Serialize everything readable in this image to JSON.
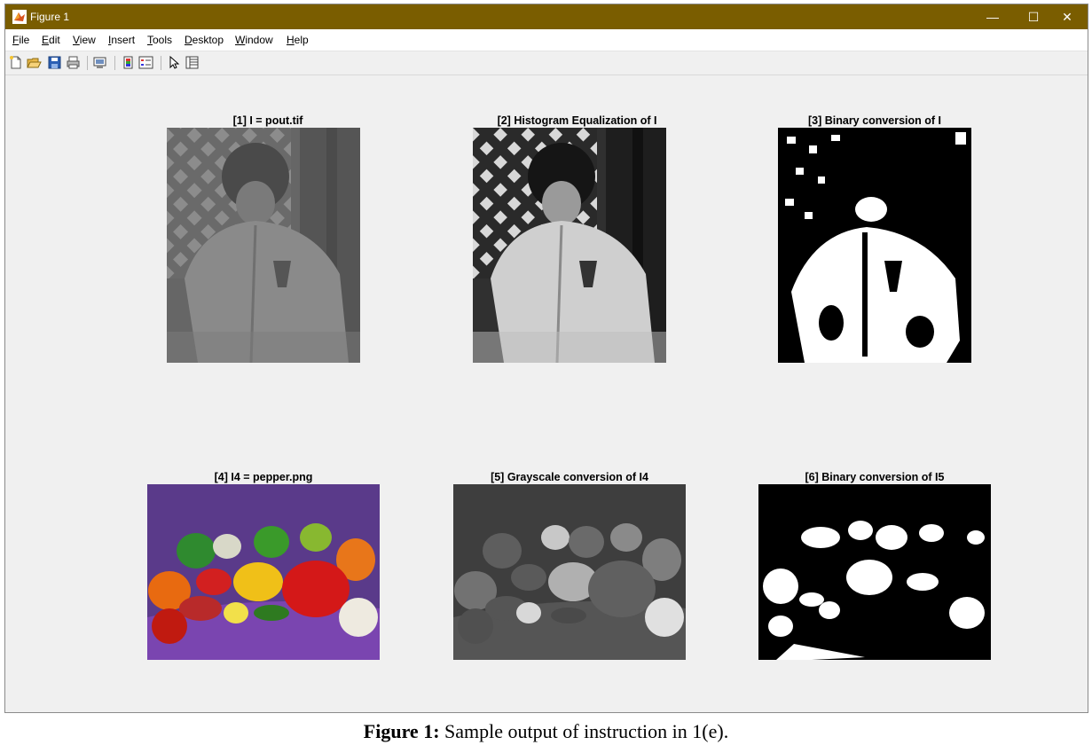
{
  "window": {
    "title": "Figure 1",
    "app_icon": "matlab-icon",
    "controls": [
      "—",
      "☐",
      "✕"
    ],
    "accent": "#7a5d00"
  },
  "menu": [
    {
      "label": "File"
    },
    {
      "label": "Edit"
    },
    {
      "label": "View"
    },
    {
      "label": "Insert"
    },
    {
      "label": "Tools"
    },
    {
      "label": "Desktop"
    },
    {
      "label": "Window"
    },
    {
      "label": "Help"
    }
  ],
  "toolbar": {
    "icons": [
      "new-figure-icon",
      "open-file-icon",
      "save-icon",
      "print-icon",
      "link-plot-icon",
      "colorbar-icon",
      "legend-icon",
      "pointer-icon",
      "property-editor-icon"
    ]
  },
  "subplots": [
    {
      "title": "[1] I = pout.tif"
    },
    {
      "title": "[2] Histogram Equalization of I"
    },
    {
      "title": "[3] Binary conversion of I"
    },
    {
      "title": "[4] I4 = pepper.png"
    },
    {
      "title": "[5] Grayscale conversion of I4"
    },
    {
      "title": "[6] Binary conversion of I5"
    }
  ],
  "caption": {
    "label": "Figure 1:",
    "text": " Sample output of instruction in 1(e)."
  }
}
